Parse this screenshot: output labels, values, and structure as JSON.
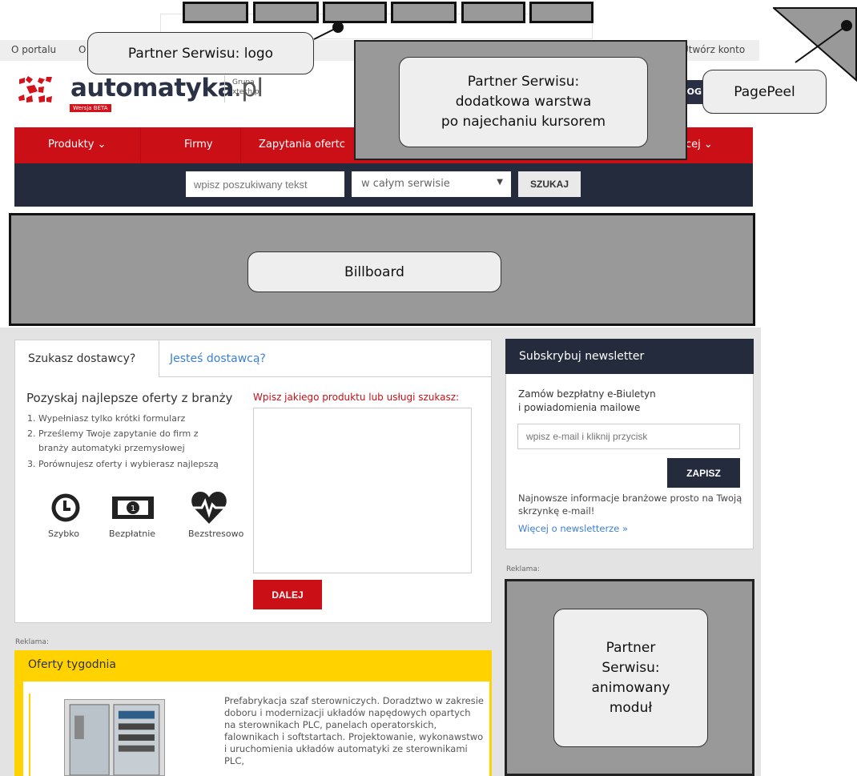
{
  "topbar": {
    "about": "O portalu",
    "about2": "O",
    "create_account": "Utwórz konto"
  },
  "header": {
    "logo_main": "automatyka",
    "logo_tld": ".pl",
    "beta": "Wersja BETA",
    "grupa_line1": "Grupa",
    "grupa_line2": "xtech.pl",
    "login": "LOG"
  },
  "nav": {
    "items": [
      "Produkty ⌄",
      "Firmy",
      "Zapytania ofertc",
      "cej ⌄"
    ]
  },
  "search": {
    "placeholder": "wpisz poszukiwany tekst",
    "scope": "w całym serwisie",
    "button": "SZUKAJ"
  },
  "callouts": {
    "logo": "Partner Serwisu: logo",
    "hover": "Partner Serwisu:\ndodatkowa warstwa\npo najechaniu kursorem",
    "pagepeel": "PagePeel",
    "billboard": "Billboard",
    "animated": "Partner\nSerwisu:\nanimowany\nmoduł"
  },
  "form": {
    "tab_active": "Szukasz dostawcy?",
    "tab_inactive": "Jesteś dostawcą?",
    "heading": "Pozyskaj najlepsze oferty z branży",
    "steps": [
      "1. Wypełniasz tylko krótki formularz",
      "2. Prześlemy Twoje zapytanie do firm z",
      "branży automatyki przemysłowej",
      "3. Porównujesz oferty i wybierasz najlepszą"
    ],
    "features": [
      "Szybko",
      "Bezpłatnie",
      "Bezstresowo"
    ],
    "question_label": "Wpisz jakiego produktu lub usługi szukasz:",
    "submit": "DALEJ"
  },
  "newsletter": {
    "title": "Subskrybuj newsletter",
    "line1": "Zamów bezpłatny e-Biuletyn",
    "line2": "i powiadomienia mailowe",
    "placeholder": "wpisz e-mail i kliknij przycisk",
    "button": "ZAPISZ",
    "info": "Najnowsze informacje branżowe prosto na Twoją skrzynkę e-mail!",
    "link": "Więcej o newsletterze »"
  },
  "reklama": "Reklama:",
  "offers": {
    "title": "Oferty tygodnia",
    "text": "Prefabrykacja szaf sterowniczych. Doradztwo w zakresie doboru i modernizacji układów napędowych opartych na sterownikach PLC, panelach operatorskich, falownikach i softstartach. Projektowanie, wykonawstwo i uruchomienia układów automatyki ze sterownikami PLC,"
  }
}
